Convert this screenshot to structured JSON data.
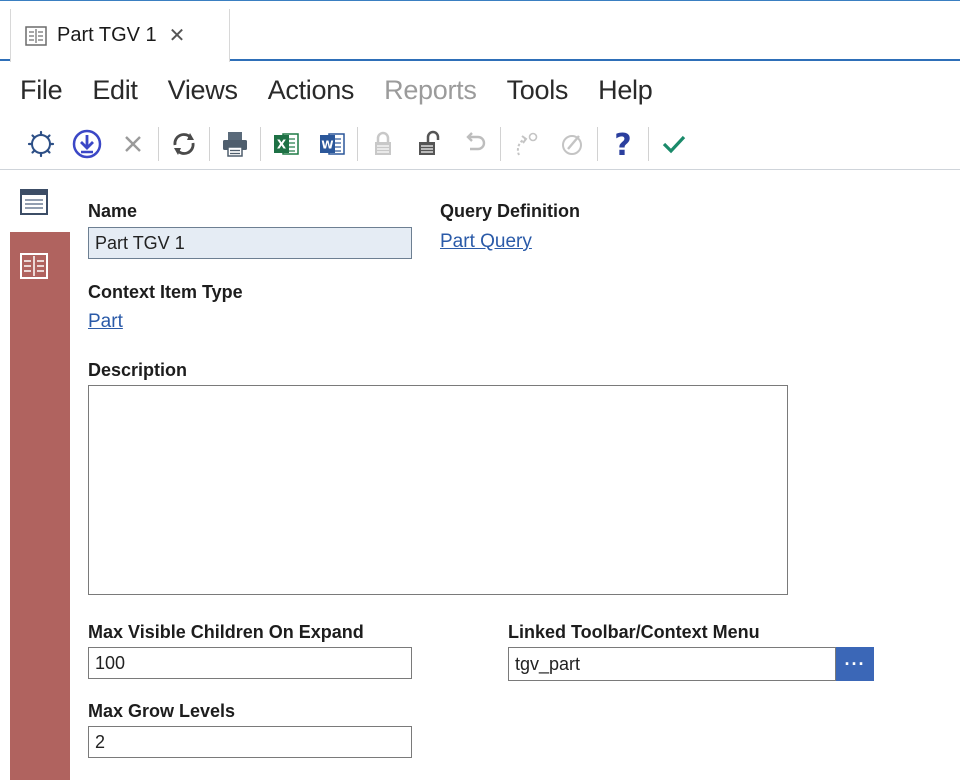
{
  "tab": {
    "title": "Part TGV 1",
    "close": "✕",
    "icon": "item-form-icon"
  },
  "menu": [
    {
      "label": "File",
      "enabled": true
    },
    {
      "label": "Edit",
      "enabled": true
    },
    {
      "label": "Views",
      "enabled": true
    },
    {
      "label": "Actions",
      "enabled": true
    },
    {
      "label": "Reports",
      "enabled": false
    },
    {
      "label": "Tools",
      "enabled": true
    },
    {
      "label": "Help",
      "enabled": true
    }
  ],
  "toolbar": [
    "new-icon",
    "save-icon",
    "delete-icon",
    "refresh-icon",
    "print-icon",
    "export-excel-icon",
    "export-word-icon",
    "lock-icon",
    "unlock-icon",
    "undo-icon",
    "redo-icon",
    "edit-icon",
    "help-icon",
    "done-icon"
  ],
  "form": {
    "name_label": "Name",
    "name_value": "Part TGV 1",
    "query_def_label": "Query Definition",
    "query_def_link": "Part Query",
    "context_type_label": "Context Item Type",
    "context_type_link": "Part",
    "description_label": "Description",
    "description_value": "",
    "max_children_label": "Max Visible Children On Expand",
    "max_children_value": "100",
    "linked_toolbar_label": "Linked Toolbar/Context Menu",
    "linked_toolbar_value": "tgv_part",
    "linked_toolbar_button": "···",
    "max_grow_label": "Max Grow Levels",
    "max_grow_value": "2"
  },
  "colors": {
    "accent": "#2e6fb8",
    "rail": "#b0635f",
    "link": "#2a5aa8",
    "readonly_field": "#e5ecf4",
    "check": "#1a8a6a"
  }
}
